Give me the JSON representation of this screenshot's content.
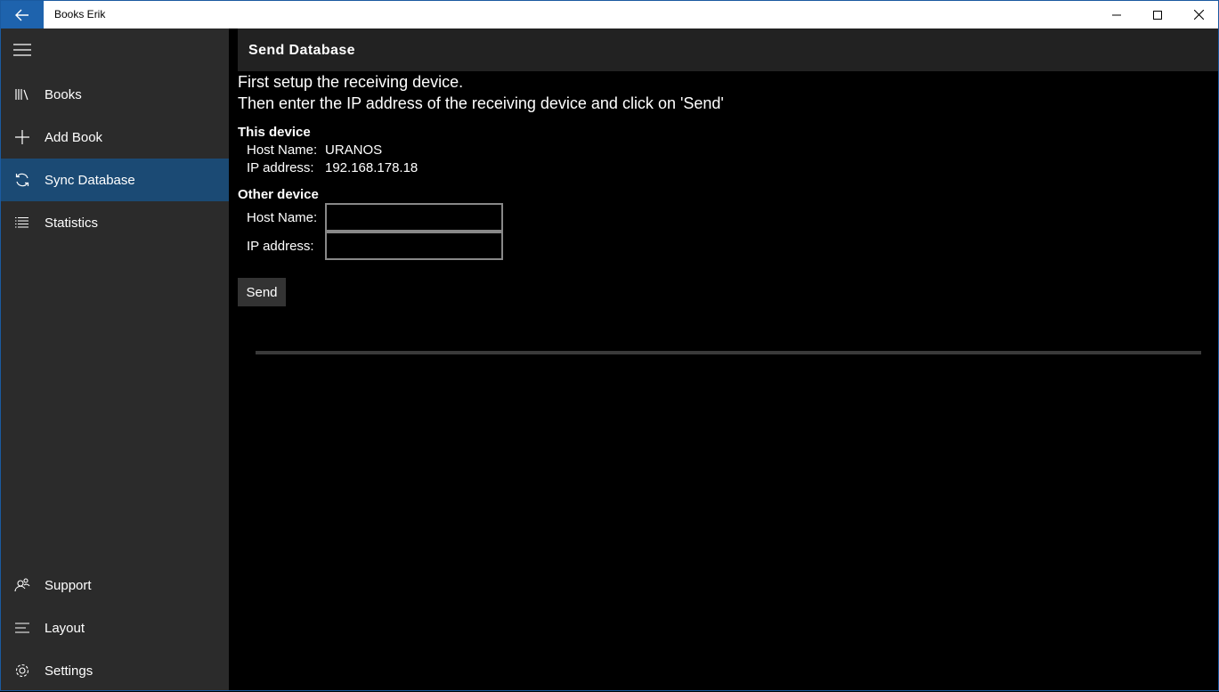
{
  "window": {
    "title": "Books Erik"
  },
  "sidebar": {
    "top_items": [
      {
        "label": "Books",
        "icon": "library-icon"
      },
      {
        "label": "Add Book",
        "icon": "plus-icon"
      },
      {
        "label": "Sync Database",
        "icon": "sync-icon",
        "selected": true
      },
      {
        "label": "Statistics",
        "icon": "list-icon"
      }
    ],
    "bottom_items": [
      {
        "label": "Support",
        "icon": "people-icon"
      },
      {
        "label": "Layout",
        "icon": "align-left-icon"
      },
      {
        "label": "Settings",
        "icon": "gear-icon"
      }
    ]
  },
  "page": {
    "title": "Send Database",
    "instruction_1": "First setup the receiving device.",
    "instruction_2": "Then enter the IP address of the receiving device and click on 'Send'",
    "this_device": {
      "heading": "This device",
      "host_label": "Host Name:",
      "host_value": "URANOS",
      "ip_label": "IP address:",
      "ip_value": "192.168.178.18"
    },
    "other_device": {
      "heading": "Other device",
      "host_label": "Host Name:",
      "host_value": "",
      "ip_label": "IP address:",
      "ip_value": ""
    },
    "send_label": "Send",
    "progress": 0
  },
  "colors": {
    "accent": "#1e63ad",
    "selected_nav": "#1b4a74",
    "sidebar_bg": "#2b2b2b",
    "content_bg": "#000000"
  }
}
